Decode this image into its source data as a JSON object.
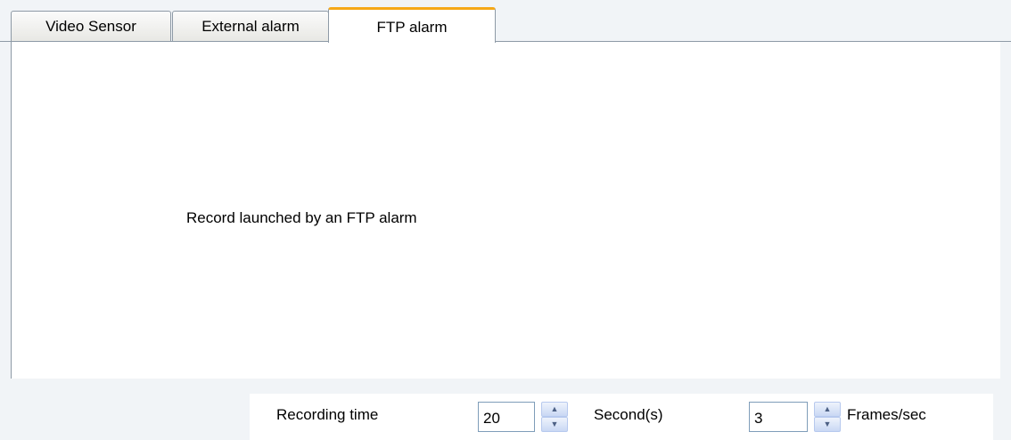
{
  "tabs": [
    {
      "label": "Video Sensor",
      "active": false
    },
    {
      "label": "External alarm",
      "active": false
    },
    {
      "label": "FTP alarm",
      "active": true
    }
  ],
  "panel": {
    "description": "Record launched by an FTP alarm"
  },
  "recording": {
    "time_label": "Recording time",
    "time_value": "20",
    "time_unit": "Second(s)",
    "frame_value": "3",
    "frame_unit": "Frames/sec"
  },
  "icons": {
    "spin_up": "chevron-up-icon",
    "spin_down": "chevron-down-icon"
  },
  "colors": {
    "active_tab_accent": "#f5a818",
    "tab_border": "#8e9aa6",
    "input_border": "#7f9db9"
  }
}
